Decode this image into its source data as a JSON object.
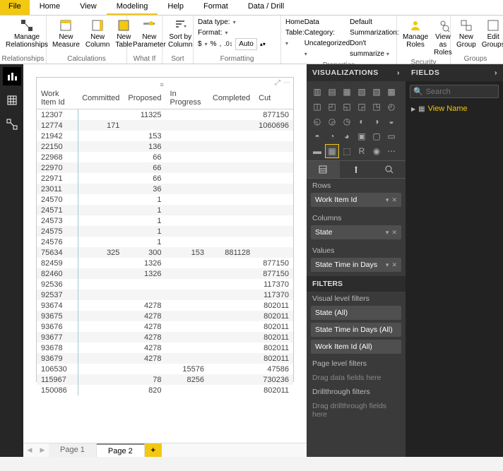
{
  "top_tabs": {
    "file": "File",
    "home": "Home",
    "view": "View",
    "modeling": "Modeling",
    "help": "Help",
    "format": "Format",
    "data_drill": "Data / Drill"
  },
  "ribbon": {
    "relationships": {
      "manage": "Manage\nRelationships",
      "group": "Relationships"
    },
    "calculations": {
      "measure": "New\nMeasure",
      "column": "New\nColumn",
      "table": "New\nTable",
      "group": "Calculations"
    },
    "whatif": {
      "param": "New\nParameter",
      "group": "What If"
    },
    "sort": {
      "sortby": "Sort by\nColumn",
      "group": "Sort"
    },
    "formatting": {
      "datatype": "Data type:",
      "format": "Format:",
      "currency": "$",
      "percent": "%",
      "comma": ",",
      "auto": "Auto",
      "group": "Formatting"
    },
    "properties": {
      "hometable": "Home Table:",
      "datacategory": "Data Category: Uncategorized",
      "summarization": "Default Summarization: Don't summarize",
      "group": "Properties"
    },
    "security": {
      "manage": "Manage\nRoles",
      "viewas": "View as\nRoles",
      "group": "Security"
    },
    "groups": {
      "new": "New\nGroup",
      "edit": "Edit\nGroups",
      "group": "Groups"
    }
  },
  "matrix": {
    "headers": [
      "Work Item Id",
      "Committed",
      "Proposed",
      "In Progress",
      "Completed",
      "Cut"
    ],
    "rows": [
      [
        "12307",
        "",
        "11325",
        "",
        "",
        "877150"
      ],
      [
        "12774",
        "171",
        "",
        "",
        "",
        "1060696"
      ],
      [
        "21942",
        "",
        "153",
        "",
        "",
        ""
      ],
      [
        "22150",
        "",
        "136",
        "",
        "",
        ""
      ],
      [
        "22968",
        "",
        "66",
        "",
        "",
        ""
      ],
      [
        "22970",
        "",
        "66",
        "",
        "",
        ""
      ],
      [
        "22971",
        "",
        "66",
        "",
        "",
        ""
      ],
      [
        "23011",
        "",
        "36",
        "",
        "",
        ""
      ],
      [
        "24570",
        "",
        "1",
        "",
        "",
        ""
      ],
      [
        "24571",
        "",
        "1",
        "",
        "",
        ""
      ],
      [
        "24573",
        "",
        "1",
        "",
        "",
        ""
      ],
      [
        "24575",
        "",
        "1",
        "",
        "",
        ""
      ],
      [
        "24576",
        "",
        "1",
        "",
        "",
        ""
      ],
      [
        "75634",
        "325",
        "300",
        "153",
        "881128",
        ""
      ],
      [
        "82459",
        "",
        "1326",
        "",
        "",
        "877150"
      ],
      [
        "82460",
        "",
        "1326",
        "",
        "",
        "877150"
      ],
      [
        "92536",
        "",
        "",
        "",
        "",
        "117370"
      ],
      [
        "92537",
        "",
        "",
        "",
        "",
        "117370"
      ],
      [
        "93674",
        "",
        "4278",
        "",
        "",
        "802011"
      ],
      [
        "93675",
        "",
        "4278",
        "",
        "",
        "802011"
      ],
      [
        "93676",
        "",
        "4278",
        "",
        "",
        "802011"
      ],
      [
        "93677",
        "",
        "4278",
        "",
        "",
        "802011"
      ],
      [
        "93678",
        "",
        "4278",
        "",
        "",
        "802011"
      ],
      [
        "93679",
        "",
        "4278",
        "",
        "",
        "802011"
      ],
      [
        "106530",
        "",
        "",
        "15576",
        "",
        "47586"
      ],
      [
        "115967",
        "",
        "78",
        "8256",
        "",
        "730236"
      ],
      [
        "150086",
        "",
        "820",
        "",
        "",
        "802011"
      ]
    ]
  },
  "page_tabs": {
    "p1": "Page 1",
    "p2": "Page 2",
    "add": "+"
  },
  "viz_pane": {
    "title": "VISUALIZATIONS",
    "rows": "Rows",
    "row_field": "Work Item Id",
    "columns": "Columns",
    "col_field": "State",
    "values": "Values",
    "val_field": "State Time in Days",
    "filters_title": "FILTERS",
    "visual_filters": "Visual level filters",
    "f1": "State  (All)",
    "f2": "State Time in Days  (All)",
    "f3": "Work Item Id  (All)",
    "page_filters": "Page level filters",
    "drag1": "Drag data fields here",
    "drill_filters": "Drillthrough filters",
    "drag2": "Drag drillthrough fields here"
  },
  "fields_pane": {
    "title": "FIELDS",
    "search_ph": "Search",
    "view_name": "View Name"
  }
}
